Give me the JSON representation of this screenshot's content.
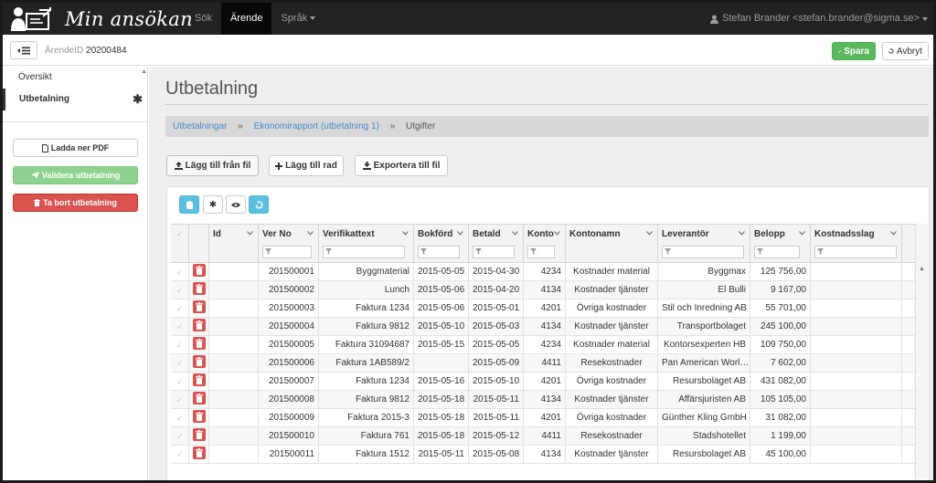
{
  "navbar": {
    "title": "Min ansökan",
    "links": [
      {
        "label": "Sök",
        "active": false
      },
      {
        "label": "Ärende",
        "active": true
      },
      {
        "label": "Språk",
        "active": false,
        "dropdown": true
      }
    ],
    "user": "Stefan Brander <stefan.brander@sigma.se>"
  },
  "subbar": {
    "case_prefix": "ÄrendeID",
    "case_id": "20200484",
    "save_label": "Spara",
    "cancel_label": "Avbryt"
  },
  "sidebar": {
    "items": [
      {
        "label": "Översikt",
        "active": false
      },
      {
        "label": "Utbetalning",
        "active": true,
        "marker": "✱"
      }
    ],
    "pdf_label": "Ladda ner PDF",
    "validate_label": "Validera utbetalning",
    "delete_label": "Ta bort utbetalning"
  },
  "main": {
    "title": "Utbetalning",
    "breadcrumb": {
      "items": [
        "Utbetalningar",
        "Ekonomirapport (utbetalning 1)"
      ],
      "current": "Utgifter",
      "separator": "»"
    },
    "buttons": {
      "import": "Lägg till från fil",
      "add_row": "Lägg till rad",
      "export": "Exportera till fil"
    },
    "grid": {
      "columns": [
        "Id",
        "Ver No",
        "Verifikattext",
        "Bokförd",
        "Betald",
        "Konto",
        "Kontonamn",
        "Leverantör",
        "Belopp",
        "Kostnadsslag"
      ],
      "rows": [
        [
          "",
          "201500001",
          "Byggmaterial",
          "2015-05-05",
          "2015-04-30",
          "4234",
          "Kostnader material",
          "Byggmax",
          "125 756,00",
          ""
        ],
        [
          "",
          "201500002",
          "Lunch",
          "2015-05-06",
          "2015-04-20",
          "4134",
          "Kostnader tjänster",
          "El Bulli",
          "9 167,00",
          ""
        ],
        [
          "",
          "201500003",
          "Faktura 1234",
          "2015-05-06",
          "2015-05-01",
          "4201",
          "Övriga kostnader",
          "Stil och Inredning AB",
          "55 701,00",
          ""
        ],
        [
          "",
          "201500004",
          "Faktura 9812",
          "2015-05-10",
          "2015-05-03",
          "4134",
          "Kostnader tjänster",
          "Transportbolaget",
          "245 100,00",
          ""
        ],
        [
          "",
          "201500005",
          "Faktura 31094687",
          "2015-05-15",
          "2015-05-05",
          "4234",
          "Kostnader material",
          "Kontorsexperten HB",
          "109 750,00",
          ""
        ],
        [
          "",
          "201500006",
          "Faktura 1AB589/2",
          "",
          "2015-05-09",
          "4411",
          "Resekostnader",
          "Pan American Worl…",
          "7 602,00",
          ""
        ],
        [
          "",
          "201500007",
          "Faktura 1234",
          "2015-05-16",
          "2015-05-10",
          "4201",
          "Övriga kostnader",
          "Resursbolaget AB",
          "431 082,00",
          ""
        ],
        [
          "",
          "201500008",
          "Faktura 9812",
          "2015-05-18",
          "2015-05-11",
          "4134",
          "Kostnader tjänster",
          "Affärsjuristen AB",
          "105 105,00",
          ""
        ],
        [
          "",
          "201500009",
          "Faktura 2015-3",
          "2015-05-18",
          "2015-05-11",
          "4201",
          "Övriga kostnader",
          "Günther Kling GmbH",
          "31 082,00",
          ""
        ],
        [
          "",
          "201500010",
          "Faktura 761",
          "2015-05-18",
          "2015-05-12",
          "4411",
          "Resekostnader",
          "Stadshotellet",
          "1 199,00",
          ""
        ],
        [
          "",
          "201500011",
          "Faktura 1512",
          "2015-05-11",
          "2015-05-08",
          "4134",
          "Kostnader tjänster",
          "Resursbolaget AB",
          "45 100,00",
          ""
        ]
      ]
    }
  }
}
